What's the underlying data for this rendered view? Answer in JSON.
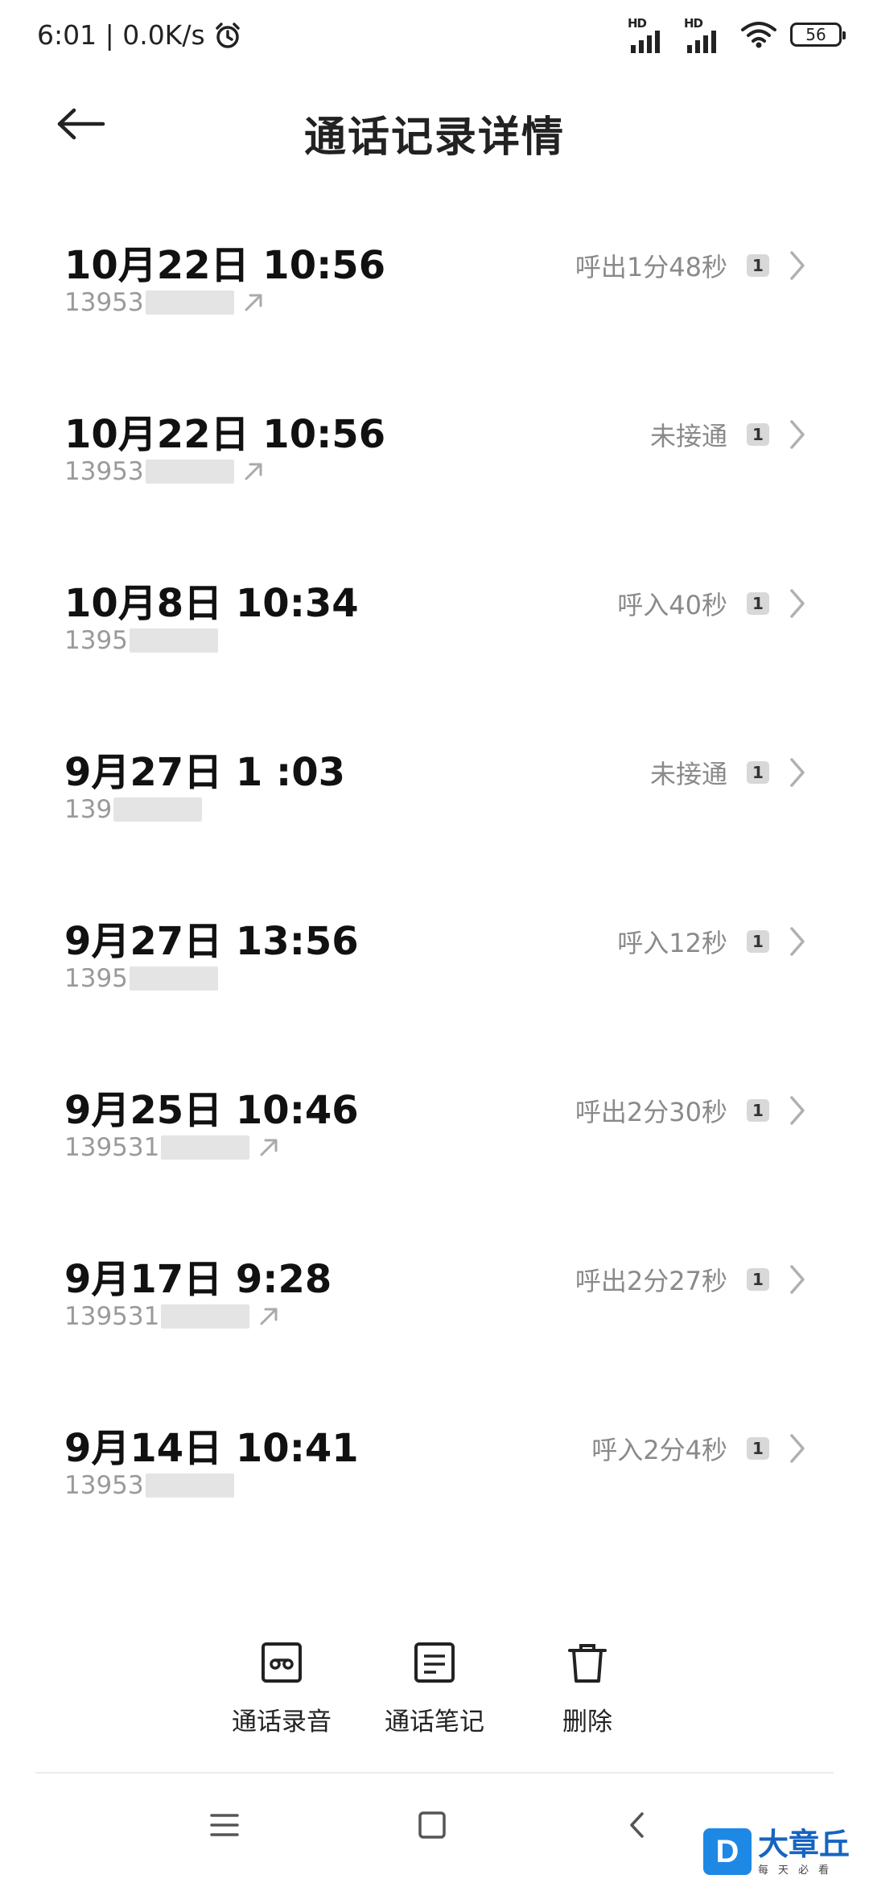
{
  "status_bar": {
    "time_speed": "6:01 | 0.0K/s",
    "sim1_label": "HD",
    "sim2_label": "HD",
    "battery": "56"
  },
  "header": {
    "title": "通话记录详情"
  },
  "calls": [
    {
      "date": "10月22日 10:56",
      "number": "13953",
      "status": "呼出1分48秒",
      "sim": "1",
      "outgoing": true
    },
    {
      "date": "10月22日 10:56",
      "number": "13953",
      "status": "未接通",
      "sim": "1",
      "outgoing": true
    },
    {
      "date": "10月8日 10:34",
      "number": "1395",
      "status": "呼入40秒",
      "sim": "1",
      "outgoing": false
    },
    {
      "date": "9月27日 1 :03",
      "number": "139",
      "status": "未接通",
      "sim": "1",
      "outgoing": false
    },
    {
      "date": "9月27日 13:56",
      "number": "1395",
      "status": "呼入12秒",
      "sim": "1",
      "outgoing": false
    },
    {
      "date": "9月25日 10:46",
      "number": "139531",
      "status": "呼出2分30秒",
      "sim": "1",
      "outgoing": true
    },
    {
      "date": "9月17日 9:28",
      "number": "139531",
      "status": "呼出2分27秒",
      "sim": "1",
      "outgoing": true
    },
    {
      "date": "9月14日 10:41",
      "number": "13953",
      "status": "呼入2分4秒",
      "sim": "1",
      "outgoing": false
    }
  ],
  "actions": {
    "record_label": "通话录音",
    "notes_label": "通话笔记",
    "delete_label": "删除"
  },
  "watermark": {
    "logo": "D",
    "name": "大章丘",
    "slogan": "每天必看"
  }
}
